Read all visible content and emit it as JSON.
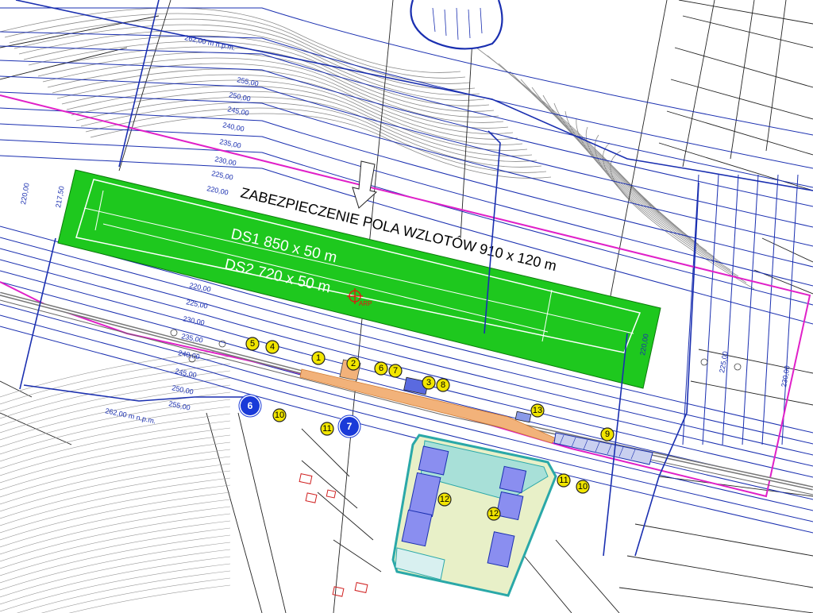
{
  "map": {
    "runway_area_label": "ZABEZPIECZENIE POLA WZLOTÓW 910 x 120 m",
    "runway1_label": "DS1 850 x 50 m",
    "runway2_label": "DS2 720 x 50 m",
    "arp_label": "ARP",
    "colors": {
      "runway_fill": "#1ec81e",
      "contour_blue": "#1a2fb0",
      "boundary_magenta": "#e020c8",
      "marker_yellow": "#f2e600",
      "marker_blue": "#1a3ad8",
      "building_fill": "#c9d9ff",
      "site_fill": "#e8f0c8",
      "apron_orange": "#f2b27a"
    },
    "contour_labels": [
      "262,00 m n.p.m.",
      "255,00",
      "250,00",
      "245,00",
      "240,00",
      "235,00",
      "230,00",
      "225,00",
      "220,00",
      "220,00",
      "217,50",
      "220,00",
      "225,00",
      "230,00",
      "235,00",
      "240,00",
      "245,00",
      "250,00",
      "255,00",
      "262,00 m n.p.m.",
      "220,00",
      "225,00",
      "230,00"
    ],
    "markers_yellow": [
      "1",
      "2",
      "3",
      "4",
      "5",
      "6",
      "7",
      "8",
      "9",
      "10",
      "11",
      "13",
      "11",
      "10",
      "12",
      "12"
    ],
    "markers_blue": [
      "6",
      "7"
    ]
  }
}
